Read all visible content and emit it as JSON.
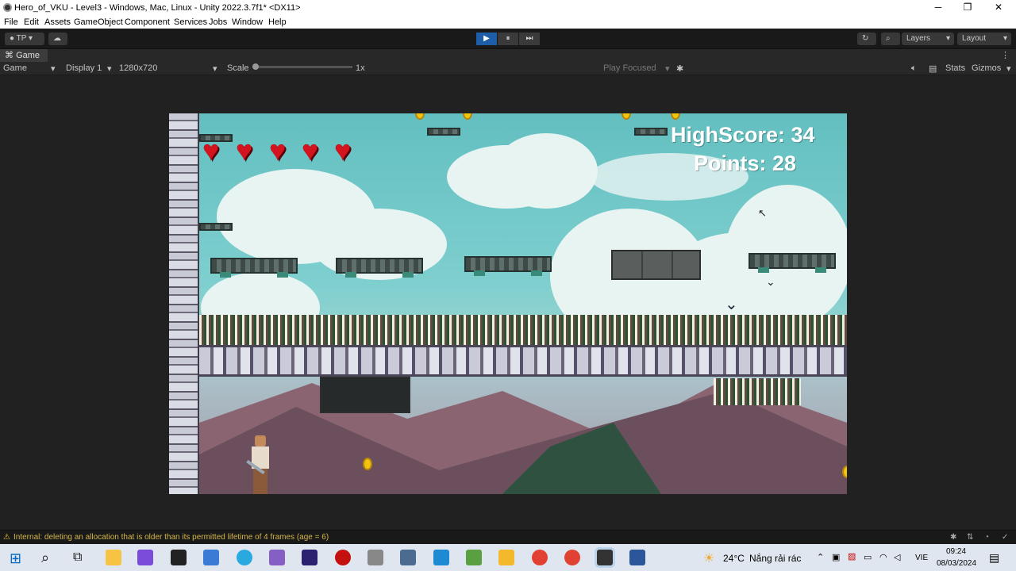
{
  "window": {
    "title": "Hero_of_VKU - Level3 - Windows, Mac, Linux - Unity 2022.3.7f1* <DX11>",
    "minimize": "─",
    "restore": "❐",
    "close": "✕"
  },
  "menu": [
    "File",
    "Edit",
    "Assets",
    "GameObject",
    "Component",
    "Services",
    "Jobs",
    "Window",
    "Help"
  ],
  "toolbar": {
    "account": "TP",
    "play": "▶",
    "pause": "⏸",
    "step": "⏭",
    "layers": "Layers",
    "layout": "Layout"
  },
  "tab": {
    "label": "Game"
  },
  "gamebar": {
    "mode": "Game",
    "display": "Display 1",
    "resolution": "1280x720",
    "scale_label": "Scale",
    "scale_value": "1x",
    "play_focused": "Play Focused",
    "stats": "Stats",
    "gizmos": "Gizmos"
  },
  "hud": {
    "highscore": "HighScore: 34",
    "points": "Points: 28",
    "hearts": 5
  },
  "status": {
    "message": "Internal: deleting an allocation that is older than its permitted lifetime of 4 frames (age = 6)"
  },
  "taskbar": {
    "weather_temp": "24°C",
    "weather_text": "Nắng rải rác",
    "lang": "VIE",
    "time": "09:24",
    "date": "08/03/2024"
  },
  "colors": {
    "accent_play": "#1e5ea8",
    "heart": "#d3131d",
    "warning": "#d4b64a"
  }
}
